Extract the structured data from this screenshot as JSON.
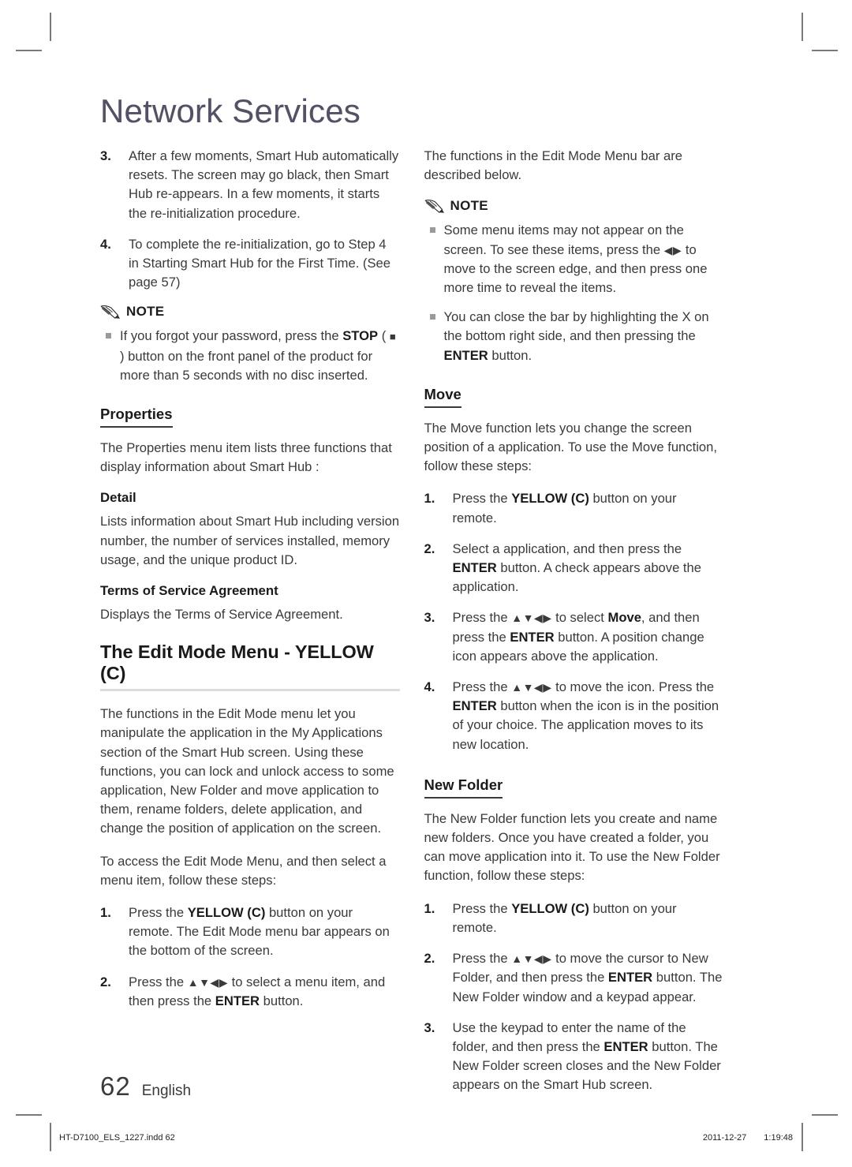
{
  "page": {
    "title": "Network Services",
    "number": "62",
    "language": "English"
  },
  "slug": {
    "file": "HT-D7100_ELS_1227.indd   62",
    "date": "2011-12-27",
    "time": "1:19:48"
  },
  "left_column": {
    "step3": {
      "num": "3.",
      "text": "After a few moments, Smart Hub automatically resets. The screen may go black, then Smart Hub re-appears. In a few moments, it starts the re-initialization procedure."
    },
    "step4": {
      "num": "4.",
      "text": "To complete the re-initialization, go to Step 4 in Starting Smart Hub for the First Time. (See page 57)"
    },
    "note": {
      "label": "NOTE",
      "items": [
        {
          "pre": "If you forgot your password, press the ",
          "bold": "STOP",
          "mid": " ( ",
          "symbol": "■",
          "post": " ) button on the front panel of the product for more than 5 seconds with no disc inserted."
        }
      ]
    },
    "properties": {
      "heading": "Properties",
      "intro": "The Properties menu item lists three functions that display information about Smart Hub :",
      "detail_heading": "Detail",
      "detail_text": "Lists information about Smart Hub including version number, the number of services installed, memory usage, and the unique product ID.",
      "terms_heading": "Terms of Service Agreement",
      "terms_text": "Displays the Terms of Service Agreement."
    },
    "edit_mode": {
      "heading": "The Edit Mode Menu - YELLOW (C)",
      "para1": "The functions in the Edit Mode menu let you manipulate the application in the My Applications section of the Smart Hub screen. Using these functions, you can lock and unlock access to some application, New Folder and move application to them, rename folders, delete application, and change the position of application on the screen.",
      "para2": "To access the Edit Mode Menu, and then select a menu item, follow these steps:",
      "step1": {
        "num": "1.",
        "pre": "Press the ",
        "bold": "YELLOW (C)",
        "post": " button on your remote. The Edit Mode menu bar appears on the bottom of the screen."
      },
      "step2": {
        "num": "2.",
        "pre": "Press the ",
        "arrows": "▲▼◀▶",
        "mid": " to select a menu item, and then press the ",
        "bold": "ENTER",
        "post": " button."
      }
    }
  },
  "right_column": {
    "intro": "The functions in the Edit Mode Menu bar are described below.",
    "note": {
      "label": "NOTE",
      "item1": {
        "pre": "Some menu items may not appear on the screen. To see these items, press the ",
        "arrows": "◀▶",
        "post": " to move to the screen edge, and then press one more time to reveal the items."
      },
      "item2": {
        "pre": "You can close the bar by highlighting the X on the bottom right side, and then pressing the ",
        "bold": "ENTER",
        "post": " button."
      }
    },
    "move": {
      "heading": "Move",
      "intro": "The Move function lets you change the screen position of a application. To use the Move function, follow these steps:",
      "step1": {
        "num": "1.",
        "pre": "Press the ",
        "bold": "YELLOW (C)",
        "post": " button on your remote."
      },
      "step2": {
        "num": "2.",
        "pre": "Select a application, and then press the ",
        "bold": "ENTER",
        "post": " button. A check appears above the application."
      },
      "step3": {
        "num": "3.",
        "pre": "Press the ",
        "arrows": "▲▼◀▶",
        "mid": " to select ",
        "bold1": "Move",
        "mid2": ", and then press the ",
        "bold2": "ENTER",
        "post": " button. A position change icon appears above the application."
      },
      "step4": {
        "num": "4.",
        "pre": "Press the ",
        "arrows": "▲▼◀▶",
        "mid": " to move the icon. Press the ",
        "bold": "ENTER",
        "post": " button when the icon is in the position of your choice. The application moves to its new location."
      }
    },
    "new_folder": {
      "heading": "New Folder",
      "intro": "The New Folder function lets you create and name new folders. Once you have created a folder, you can move application into it. To use the New Folder function, follow these steps:",
      "step1": {
        "num": "1.",
        "pre": "Press the ",
        "bold": "YELLOW (C)",
        "post": " button on your remote."
      },
      "step2": {
        "num": "2.",
        "pre": "Press the ",
        "arrows": "▲▼◀▶",
        "mid": " to move the cursor to New Folder, and then press the ",
        "bold": "ENTER",
        "post": " button. The New Folder window and a keypad appear."
      },
      "step3": {
        "num": "3.",
        "pre": "Use the keypad to enter the name of the folder, and then press the ",
        "bold": "ENTER",
        "post": " button. The New Folder screen closes and the New Folder appears on the Smart Hub screen."
      }
    }
  },
  "icons": {
    "note": "pencil-icon",
    "bullet": "square-bullet-icon"
  }
}
